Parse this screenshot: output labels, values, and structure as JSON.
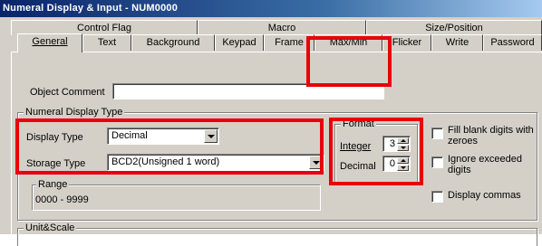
{
  "window": {
    "title": "Numeral Display & Input - NUM0000"
  },
  "tabs_top": [
    "Control Flag",
    "Macro",
    "Size/Position"
  ],
  "tabs_bottom": [
    "General",
    "Text",
    "Background",
    "Keypad",
    "Frame",
    "Max/Min",
    "Flicker",
    "Write",
    "Password"
  ],
  "general": {
    "object_comment_label": "Object Comment",
    "object_comment_value": "",
    "numeral_display_type_title": "Numeral Display Type",
    "display_type_label": "Display Type",
    "display_type_value": "Decimal",
    "storage_type_label": "Storage Type",
    "storage_type_value": "BCD2(Unsigned 1 word)",
    "range_title": "Range",
    "range_value": "0000 - 9999",
    "format_title": "Format",
    "integer_label": "Integer",
    "integer_value": "3",
    "decimal_label": "Decimal",
    "decimal_value": "0",
    "fill_blank_label": "Fill blank digits with zeroes",
    "ignore_exceeded_label": "Ignore exceeded digits",
    "display_commas_label": "Display commas",
    "unit_scale_title": "Unit&Scale"
  },
  "highlight_color": "#e8000b"
}
